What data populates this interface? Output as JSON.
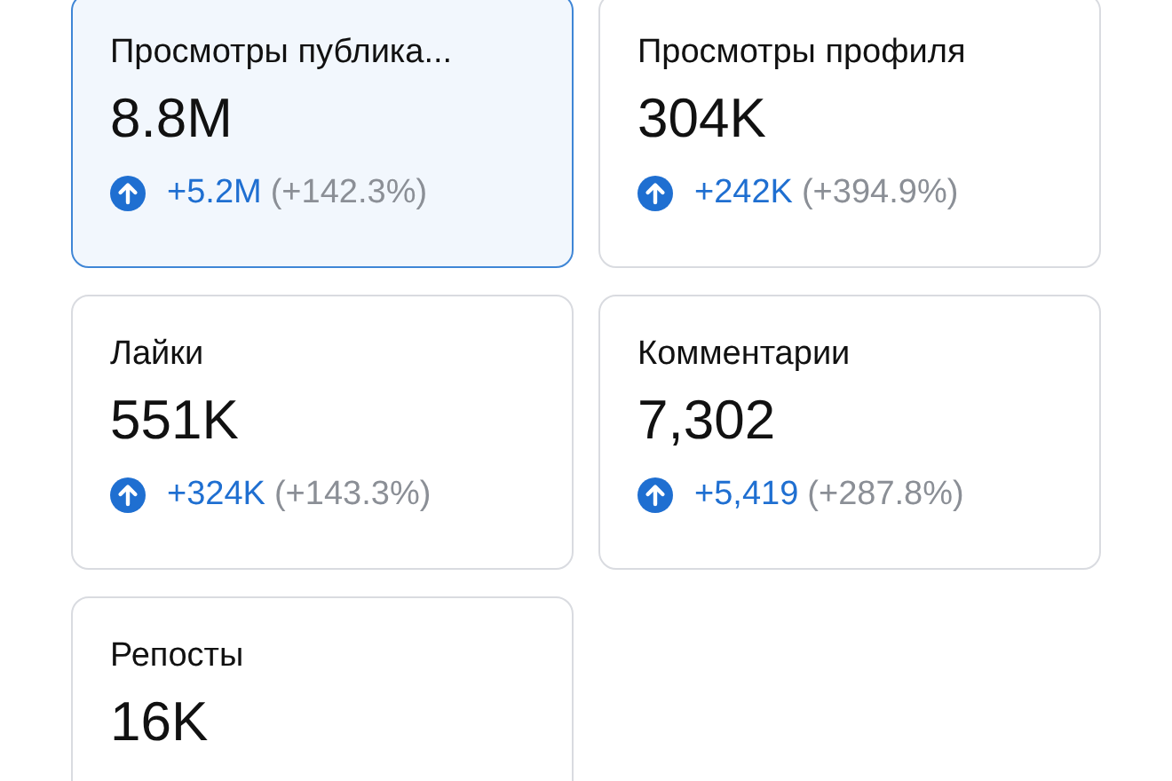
{
  "cards": [
    {
      "label": "Просмотры публика...",
      "value": "8.8M",
      "selected": true,
      "change": {
        "kind": "up",
        "delta": "+5.2M",
        "percent": "(+142.3%)"
      }
    },
    {
      "label": "Просмотры профиля",
      "value": "304K",
      "selected": false,
      "change": {
        "kind": "up",
        "delta": "+242K",
        "percent": "(+394.9%)"
      }
    },
    {
      "label": "Лайки",
      "value": "551K",
      "selected": false,
      "change": {
        "kind": "up",
        "delta": "+324K",
        "percent": "(+143.3%)"
      }
    },
    {
      "label": "Комментарии",
      "value": "7,302",
      "selected": false,
      "change": {
        "kind": "up",
        "delta": "+5,419",
        "percent": "(+287.8%)"
      }
    },
    {
      "label": "Репосты",
      "value": "16K",
      "selected": false
    }
  ]
}
